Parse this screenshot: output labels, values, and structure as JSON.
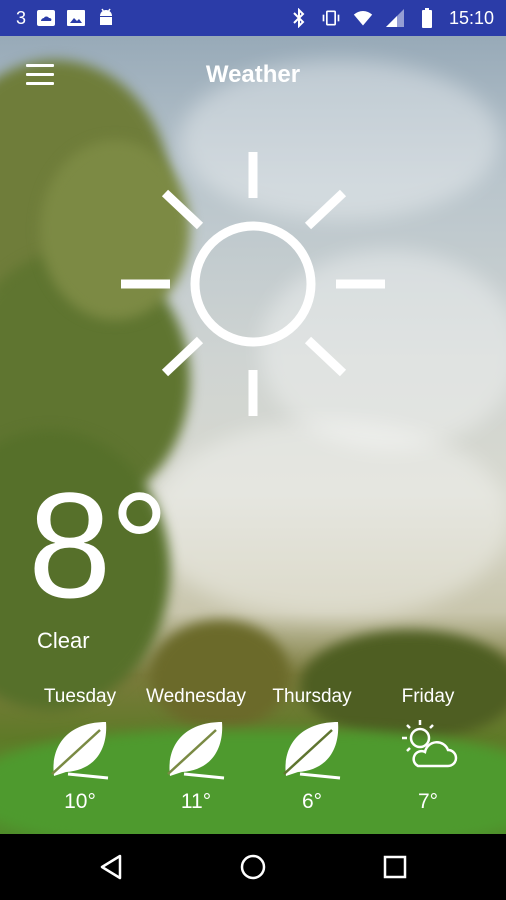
{
  "status_bar": {
    "notification_count": "3",
    "time": "15:10",
    "icons": [
      "cloud-sync-icon",
      "image-icon",
      "android-icon",
      "bluetooth-icon",
      "vibrate-icon",
      "wifi-icon",
      "cell-signal-icon",
      "battery-icon"
    ]
  },
  "app_bar": {
    "title": "Weather",
    "menu_icon": "hamburger-menu-icon"
  },
  "current": {
    "temperature": "8°",
    "condition": "Clear",
    "icon": "sun-icon"
  },
  "forecast": [
    {
      "day": "Tuesday",
      "temp": "10°",
      "icon": "leaf-icon"
    },
    {
      "day": "Wednesday",
      "temp": "11°",
      "icon": "leaf-icon"
    },
    {
      "day": "Thursday",
      "temp": "6°",
      "icon": "leaf-icon"
    },
    {
      "day": "Friday",
      "temp": "7°",
      "icon": "partly-cloudy-icon"
    }
  ],
  "nav_bar": {
    "icons": [
      "back-icon",
      "home-icon",
      "recents-icon"
    ]
  },
  "colors": {
    "status_bar": "#2b3ca8",
    "nav_bar": "#000000",
    "text": "#ffffff"
  }
}
